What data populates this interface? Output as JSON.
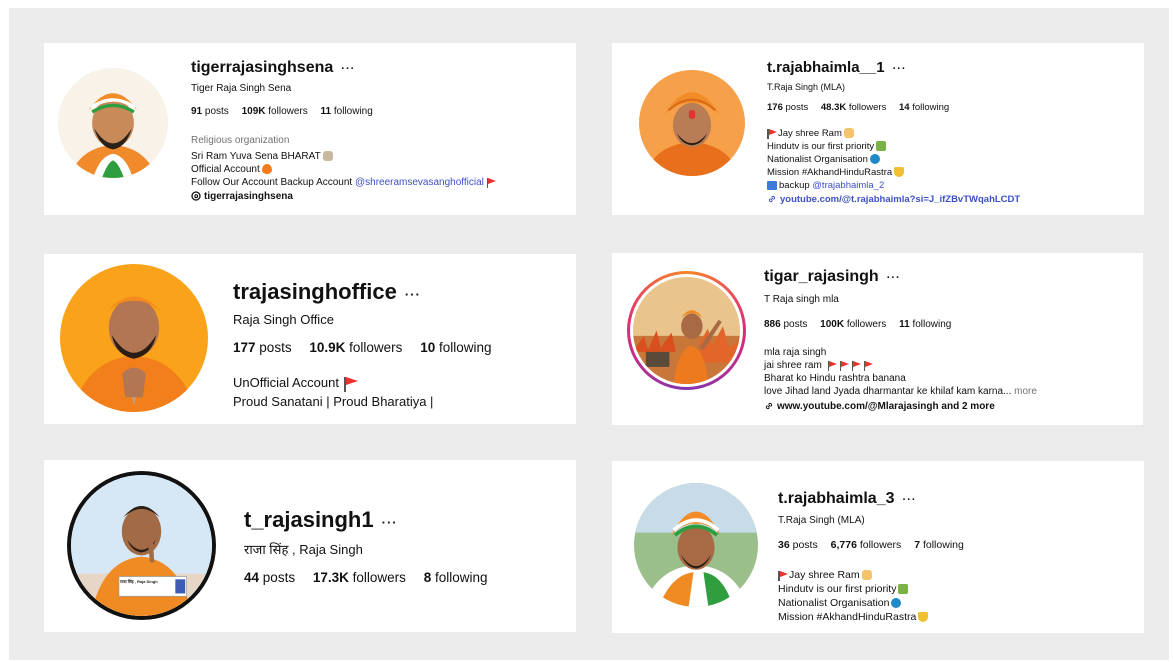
{
  "profiles": [
    {
      "username": "tigerrajasinghsena",
      "display_name": "Tiger Raja Singh Sena",
      "posts_count": "91",
      "posts_label": "posts",
      "followers_count": "109K",
      "followers_label": "followers",
      "following_count": "11",
      "following_label": "following",
      "category": "Religious organization",
      "bio": [
        "Sri Ram Yuva Sena BHARAT",
        "Official Account",
        "Follow Our Account Backup Account "
      ],
      "bio_mention": "@shreeramsevasanghofficial",
      "threads_handle": "tigerrajasinghsena"
    },
    {
      "username": "t.rajabhaimla__1",
      "display_name": "T.Raja Singh (MLA)",
      "posts_count": "176",
      "posts_label": "posts",
      "followers_count": "48.3K",
      "followers_label": "followers",
      "following_count": "14",
      "following_label": "following",
      "bio": [
        "Jay shree Ram",
        "Hindutv is our first priority",
        "Nationalist Organisation",
        "Mission #AkhandHinduRastra",
        "backup "
      ],
      "bio_mention": "@trajabhaimla_2",
      "link": "youtube.com/@t.rajabhaimla?si=J_ifZBvTWqahLCDT"
    },
    {
      "username": "trajasinghoffice",
      "display_name": "Raja Singh Office",
      "posts_count": "177",
      "posts_label": "posts",
      "followers_count": "10.9K",
      "followers_label": "followers",
      "following_count": "10",
      "following_label": "following",
      "bio": [
        "UnOfficial Account",
        "Proud Sanatani | Proud Bharatiya |"
      ]
    },
    {
      "username": "tigar_rajasingh",
      "display_name": "T Raja singh mla",
      "posts_count": "886",
      "posts_label": "posts",
      "followers_count": "100K",
      "followers_label": "followers",
      "following_count": "11",
      "following_label": "following",
      "bio": [
        "mla raja singh",
        "jai shree ram",
        "Bharat ko Hindu rashtra banana",
        "love Jihad land Jyada dharmantar ke khilaf kam karna..."
      ],
      "more_label": "more",
      "link": "www.youtube.com/@Mlarajasingh and 2 more"
    },
    {
      "username": "t_rajasingh1",
      "display_name": "राजा सिंह , Raja Singh",
      "posts_count": "44",
      "posts_label": "posts",
      "followers_count": "17.3K",
      "followers_label": "followers",
      "following_count": "8",
      "following_label": "following",
      "banner_text": "राजा सिंह , Raja Singh"
    },
    {
      "username": "t.rajabhaimla_3",
      "display_name": "T.Raja Singh (MLA)",
      "posts_count": "36",
      "posts_label": "posts",
      "followers_count": "6,776",
      "followers_label": "followers",
      "following_count": "7",
      "following_label": "following",
      "bio": [
        "Jay shree Ram",
        "Hindutv is our first priority",
        "Nationalist Organisation",
        "Mission #AkhandHinduRastra"
      ]
    }
  ],
  "menu_label": "···",
  "colors": {
    "saffron": "#f28c28",
    "link_blue": "#3c50c8",
    "muted_grey": "#737373",
    "story_ring": "#d62976"
  }
}
